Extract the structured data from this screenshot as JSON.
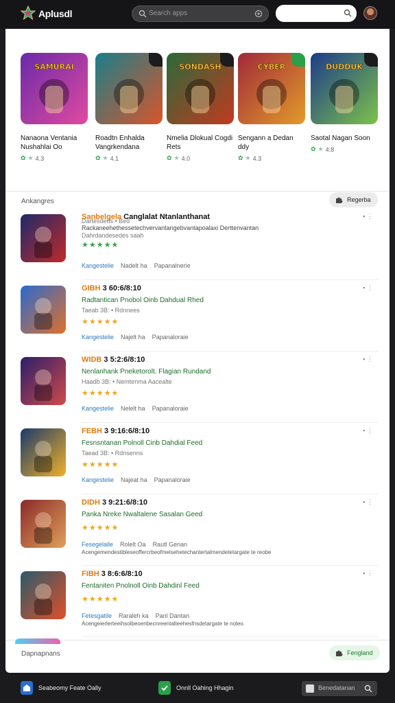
{
  "header": {
    "app_title": "Aplusdl",
    "search_placeholder": "Search apps",
    "search2_placeholder": ""
  },
  "carousel": [
    {
      "name": "Nanaona Ventania Nushahlai Oo",
      "rating": "4.3",
      "art_text": "SAMURAI",
      "color_a": "#6a2aa8",
      "color_b": "#e14aa0"
    },
    {
      "name": "Roadtn Enhalda Vangrkendana",
      "rating": "4.1",
      "art_text": "",
      "color_a": "#1a7f8a",
      "color_b": "#d9552a"
    },
    {
      "name": "Nmelia Dlokual Cogdi Rets",
      "rating": "4.0",
      "art_text": "SONDASH",
      "color_a": "#2a6a3a",
      "color_b": "#c23a20"
    },
    {
      "name": "Sengann a Dedan ddy",
      "rating": "4.3",
      "art_text": "CYBER",
      "color_a": "#a02a3a",
      "color_b": "#e39a2a"
    },
    {
      "name": "Saotal Nagan Soon",
      "rating": "4.8",
      "art_text": "DUDDUK",
      "color_a": "#1c3b8a",
      "color_b": "#7dc24a"
    }
  ],
  "section1": {
    "title": "Ankangres",
    "pill_label": "Regerba"
  },
  "list": [
    {
      "tag": "Sanbelgela",
      "line1": "Canglalat Ntanlanthanat",
      "line2": "",
      "line3": "Dartesdeds • Bed",
      "desc_inline": "Rackaneehethessetechvervantangebvantapoalaxi Derttenvantan",
      "desc_inline2": "Dahrdandesedes saah",
      "tags": [
        "Kangestelie",
        "Nadelt ha",
        "Papanalnerie"
      ],
      "stars": "★★★★★",
      "desc": "",
      "color_a": "#1e2a6a",
      "color_b": "#c02a2a"
    },
    {
      "tag": "GIBH",
      "line1": "3 60:6/8:10",
      "line2": "Radtantican Pnobol Oinb Dahdual Rhed",
      "line3": "Taeab 3B: • Rdnnees",
      "desc_inline": "",
      "desc_inline2": "",
      "tags": [
        "Kangestelie",
        "Najelt ha",
        "Papanaloraie"
      ],
      "stars": "★★★★★",
      "desc": "",
      "color_a": "#2a6ad0",
      "color_b": "#e0702a"
    },
    {
      "tag": "WIDB",
      "line1": "3 5:2:6/8:10",
      "line2": "Nenlanhank Pneketorolt. Flagian Rundand",
      "line3": "Haadb 3B: • Nemtenma Aacealte",
      "desc_inline": "",
      "desc_inline2": "",
      "tags": [
        "Kangestelie",
        "Nelelt ha",
        "Papanaloraie"
      ],
      "stars": "★★★★★",
      "desc": "",
      "color_a": "#2a1e6a",
      "color_b": "#d04a4a"
    },
    {
      "tag": "FEBH",
      "line1": "3 9:16:6/8:10",
      "line2": "Fesnsntanan Polnoll Cinb Dahdial Feed",
      "line3": "Taead 3B: • Rdnsenns",
      "desc_inline": "",
      "desc_inline2": "",
      "tags": [
        "Kangestelie",
        "Najeat ha",
        "Papanaloraie"
      ],
      "stars": "★★★★★",
      "desc": "",
      "color_a": "#1a3a6a",
      "color_b": "#f0b02a"
    },
    {
      "tag": "DIDH",
      "line1": "3 9:21:6/8:10",
      "line2": "Panka Nreke Nwaltalene Sasalan Geed",
      "line3": "",
      "desc_inline": "",
      "desc_inline2": "",
      "tags": [
        "Fesegelalle",
        "Rolelt Oa",
        "Rautl Genan"
      ],
      "stars": "★★★★★",
      "desc": "Acengemendestibleseoffercrbeofmelsehetechantertalmendetetargate te reobe",
      "color_a": "#8a2a2a",
      "color_b": "#e0a05a"
    },
    {
      "tag": "FIBH",
      "line1": "3 8:6:6/8:10",
      "line2": "Fentaniten Pnolnoll Oinb Dahdinl Feed",
      "line3": "",
      "desc_inline": "",
      "desc_inline2": "",
      "tags": [
        "Fetesgatile",
        "Raraleh ka",
        "Panl Dantan"
      ],
      "stars": "★★★★★",
      "desc": "Acengeierlerteeihsolbeoenbecnreentalteehesfnsdetargate te noleo.",
      "color_a": "#2a5a6a",
      "color_b": "#e0502a"
    }
  ],
  "section2": {
    "title": "Dapnapnans",
    "pill_label": "Fengland"
  },
  "bottom_bar": {
    "item1_label": "Seabeomy Feate Oally",
    "item2_label": "Onnll Oahing Hhagin",
    "search_label": "Benedatanan"
  },
  "colors": {
    "accent_green": "#1f7a2c",
    "star_yellow": "#f0a51e",
    "tag_orange": "#e07a10",
    "link_blue": "#2d7abf"
  }
}
